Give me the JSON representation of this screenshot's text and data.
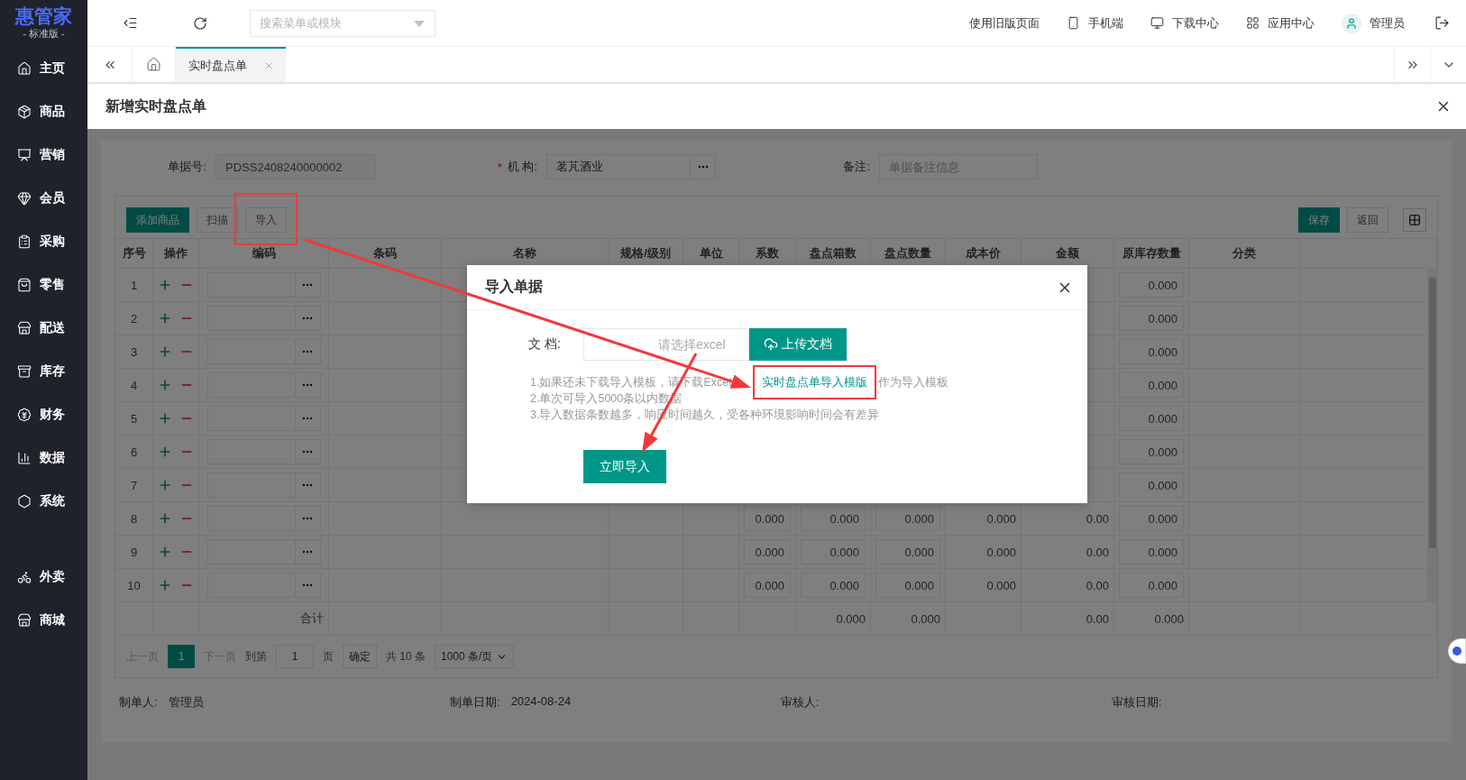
{
  "sidebar": {
    "logo": "惠管家",
    "edition": "- 标准版 -",
    "items": [
      {
        "label": "主页",
        "kind": "home"
      },
      {
        "label": "商品",
        "kind": "box"
      },
      {
        "label": "营销",
        "kind": "screen"
      },
      {
        "label": "会员",
        "kind": "gem"
      },
      {
        "label": "采购",
        "kind": "clipboard"
      },
      {
        "label": "零售",
        "kind": "bag"
      },
      {
        "label": "配送",
        "kind": "store"
      },
      {
        "label": "库存",
        "kind": "archive"
      },
      {
        "label": "财务",
        "kind": "yen"
      },
      {
        "label": "数据",
        "kind": "chart"
      },
      {
        "label": "系统",
        "kind": "hexagon"
      }
    ],
    "extra_items": [
      {
        "label": "外卖",
        "kind": "bike"
      },
      {
        "label": "商城",
        "kind": "store"
      }
    ]
  },
  "topbar": {
    "search_placeholder": "搜索菜单或模块",
    "links": [
      {
        "label": "使用旧版页面",
        "kind": "text"
      },
      {
        "label": "手机端",
        "kind": "phone"
      },
      {
        "label": "下载中心",
        "kind": "monitor"
      },
      {
        "label": "应用中心",
        "kind": "apps"
      },
      {
        "label": "管理员",
        "kind": "user"
      }
    ]
  },
  "tabs": [
    {
      "label": "实时盘点单",
      "selected": true
    }
  ],
  "page_title": "新增实时盘点单",
  "form": {
    "fields": [
      {
        "label": "单据号:",
        "kind": "readonly",
        "value": "PDSS2408240000002"
      },
      {
        "label": "机 构:",
        "kind": "picker",
        "value": "茗芃酒业",
        "required_mark": "*"
      },
      {
        "label": "备注:",
        "kind": "text",
        "placeholder": "单据备注信息"
      }
    ]
  },
  "toolbar": {
    "left": [
      {
        "label": "添加商品",
        "primary": true
      },
      {
        "label": "扫描",
        "primary": false
      },
      {
        "label": "导入",
        "primary": false
      }
    ],
    "right": [
      {
        "label": "保存",
        "primary": true
      },
      {
        "label": "返回",
        "primary": false
      }
    ]
  },
  "table": {
    "columns": [
      "序号",
      "操作",
      "编码",
      "条码",
      "名称",
      "规格/级别",
      "单位",
      "系数",
      "盘点箱数",
      "盘点数量",
      "成本价",
      "金额",
      "原库存数量",
      "分类"
    ],
    "rows": [
      {
        "index": "1",
        "stock": "0.000"
      },
      {
        "index": "2",
        "stock": "0.000"
      },
      {
        "index": "3",
        "stock": "0.000"
      },
      {
        "index": "4",
        "stock": "0.000"
      },
      {
        "index": "5",
        "stock": "0.000"
      },
      {
        "index": "6",
        "stock": "0.000"
      },
      {
        "index": "7",
        "stock": "0.000"
      },
      {
        "index": "8",
        "coef": "0.000",
        "boxes": "0.000",
        "qty": "0.000",
        "cost": "0.000",
        "amount": "0.00",
        "stock": "0.000"
      },
      {
        "index": "9",
        "coef": "0.000",
        "boxes": "0.000",
        "qty": "0.000",
        "cost": "0.000",
        "amount": "0.00",
        "stock": "0.000"
      },
      {
        "index": "10",
        "coef": "0.000",
        "boxes": "0.000",
        "qty": "0.000",
        "cost": "0.000",
        "amount": "0.00",
        "stock": "0.000"
      }
    ],
    "total": {
      "label": "合计",
      "boxes": "0.000",
      "qty": "0.000",
      "amount": "0.00",
      "stock": "0.000"
    }
  },
  "pagination": {
    "prev": {
      "label": "上一页",
      "disabled": true
    },
    "pages": [
      {
        "label": "1",
        "selected": true
      }
    ],
    "next": {
      "label": "下一页",
      "disabled": true
    },
    "goto_label": "到第",
    "goto_value": "1",
    "page_unit": "页",
    "confirm": "确定",
    "total": "共 10 条",
    "page_size": "1000 条/页"
  },
  "footer": [
    {
      "label": "制单人:",
      "value": "管理员"
    },
    {
      "label": "制单日期:",
      "value": "2024-08-24"
    },
    {
      "label": "审核人:"
    },
    {
      "label": "审核日期:"
    }
  ],
  "dialog": {
    "title": "导入单据",
    "file_label": "文 档:",
    "file_placeholder": "请选择excel",
    "upload": "上传文档",
    "note_link_line": {
      "before": "1.如果还未下载导入模板，请下载Excel",
      "link": "实时盘点单导入模版",
      "after": "作为导入模板"
    },
    "notes": [
      "2.单次可导入5000条以内数据",
      "3.导入数据条数越多，响应时间越久，受各种环境影响时间会有差异"
    ],
    "submit": "立即导入"
  }
}
